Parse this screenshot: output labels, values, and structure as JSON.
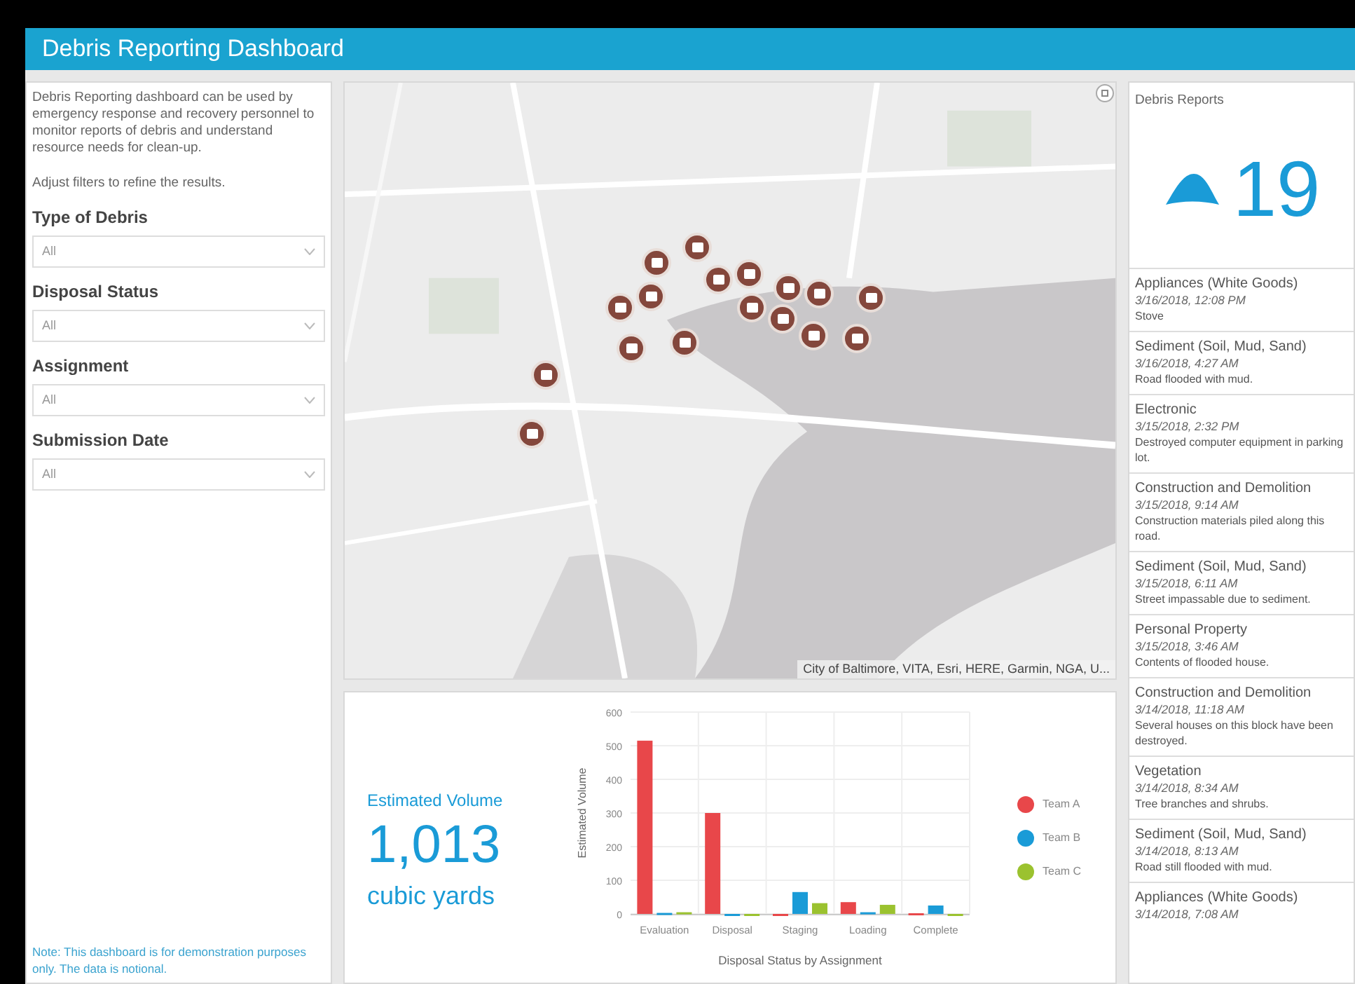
{
  "header": {
    "title": "Debris Reporting Dashboard"
  },
  "sidebar": {
    "description": "Debris Reporting dashboard can be used by emergency response and recovery personnel to monitor reports of debris and understand resource needs for clean-up.",
    "hint": "Adjust filters to refine the results.",
    "filters": [
      {
        "label": "Type of Debris",
        "value": "All"
      },
      {
        "label": "Disposal Status",
        "value": "All"
      },
      {
        "label": "Assignment",
        "value": "All"
      },
      {
        "label": "Submission Date",
        "value": "All"
      }
    ],
    "note": "Note: This dashboard is for demonstration purposes only. The data is notional."
  },
  "map": {
    "kind": "picture",
    "attribution": "City of Baltimore, VITA, Esri, HERE, Garmin, NGA, U..."
  },
  "volume": {
    "label": "Estimated Volume",
    "value": "1,013",
    "unit": "cubic yards"
  },
  "chart": {
    "chart_data": {
      "type": "bar",
      "xlabel": "Disposal Status by Assignment",
      "ylabel": "Estimated Volume",
      "categories": [
        "Evaluation",
        "Disposal",
        "Staging",
        "Loading",
        "Complete"
      ],
      "ylim": [
        0,
        600
      ],
      "grid": true,
      "legend": "right",
      "yticks": [
        0,
        100,
        200,
        300,
        400,
        500,
        600
      ],
      "series": [
        {
          "name": "Team A",
          "color": "#e8474a",
          "values": [
            515,
            300,
            0,
            35,
            2
          ]
        },
        {
          "name": "Team B",
          "color": "#1a9bd7",
          "values": [
            3,
            0,
            65,
            5,
            25
          ]
        },
        {
          "name": "Team C",
          "color": "#9bc22f",
          "values": [
            5,
            0,
            32,
            27,
            0
          ]
        }
      ]
    }
  },
  "reports": {
    "title": "Debris Reports",
    "count": "19",
    "items": [
      {
        "type": "Appliances (White Goods)",
        "date": "3/16/2018, 12:08 PM",
        "description": "Stove"
      },
      {
        "type": "Sediment (Soil, Mud, Sand)",
        "date": "3/16/2018, 4:27 AM",
        "description": "Road flooded with mud."
      },
      {
        "type": "Electronic",
        "date": "3/15/2018, 2:32 PM",
        "description": "Destroyed computer equipment in parking lot."
      },
      {
        "type": "Construction and Demolition",
        "date": "3/15/2018, 9:14 AM",
        "description": "Construction materials piled along this road."
      },
      {
        "type": "Sediment (Soil, Mud, Sand)",
        "date": "3/15/2018, 6:11 AM",
        "description": "Street impassable due to sediment."
      },
      {
        "type": "Personal Property",
        "date": "3/15/2018, 3:46 AM",
        "description": "Contents of flooded house."
      },
      {
        "type": "Construction and Demolition",
        "date": "3/14/2018, 11:18 AM",
        "description": "Several houses on this block have been destroyed."
      },
      {
        "type": "Vegetation",
        "date": "3/14/2018, 8:34 AM",
        "description": "Tree branches and shrubs."
      },
      {
        "type": "Sediment (Soil, Mud, Sand)",
        "date": "3/14/2018, 8:13 AM",
        "description": "Road still flooded with mud."
      },
      {
        "type": "Appliances (White Goods)",
        "date": "3/14/2018, 7:08 AM"
      }
    ]
  }
}
